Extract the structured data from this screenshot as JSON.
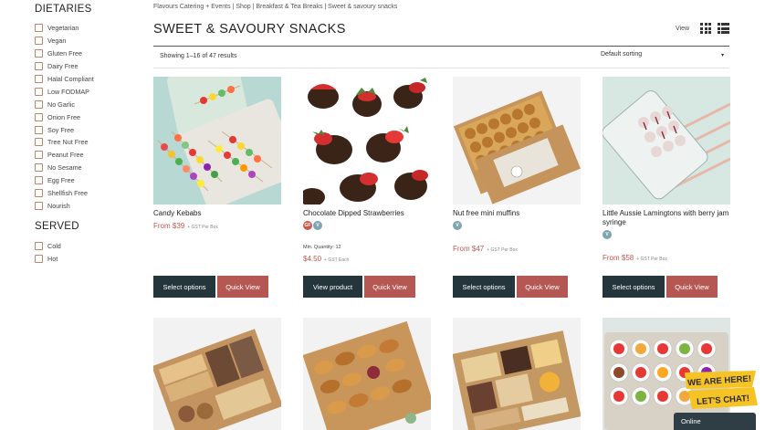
{
  "sidebar": {
    "dietaries_heading": "DIETARIES",
    "dietaries": [
      "Vegetarian",
      "Vegan",
      "Gluten Free",
      "Dairy Free",
      "Halal Compliant",
      "Low FODMAP",
      "No Garlic",
      "Onion Free",
      "Soy Free",
      "Tree Nut Free",
      "Peanut Free",
      "No Sesame",
      "Egg Free",
      "Shellfish Free",
      "Nourish"
    ],
    "served_heading": "SERVED",
    "served": [
      "Cold",
      "Hot"
    ]
  },
  "breadcrumb": "Flavours Catering + Events | Shop | Breakfast & Tea Breaks | Sweet & savoury snacks",
  "page_title": "SWEET & SAVOURY SNACKS",
  "view_label": "View",
  "result_count": "Showing 1–16 of 47 results",
  "sorting": {
    "selected": "Default sorting",
    "arrow": "▾"
  },
  "products": [
    {
      "name": "Candy Kebabs",
      "price": "From $39",
      "gst": "+ GST Per Box",
      "badges": [],
      "button1": "Select options",
      "button2": "Quick View"
    },
    {
      "name": "Chocolate Dipped Strawberries",
      "price": "$4.50",
      "gst": "+ GST Each",
      "min_qty": "Min. Quantity: 12",
      "badges": [
        "GF",
        "V"
      ],
      "button1": "View product",
      "button2": "Quick View"
    },
    {
      "name": "Nut free mini muffins",
      "price": "From $47",
      "gst": "+ GST Per Box",
      "badges": [
        "V"
      ],
      "button1": "Select options",
      "button2": "Quick View"
    },
    {
      "name": "Little Aussie Lamingtons with berry jam syringe",
      "price": "From $58",
      "gst": "+ GST Per Box",
      "badges": [
        "V"
      ],
      "button1": "Select options",
      "button2": "Quick View"
    }
  ],
  "chat": {
    "line1": "WE ARE HERE!",
    "line2": "LET'S CHAT!",
    "status": "Online"
  },
  "colors": {
    "dark_button": "#24353c",
    "accent_red": "#b55753",
    "price": "#c0574e",
    "checkbox_border": "#b8876f"
  }
}
